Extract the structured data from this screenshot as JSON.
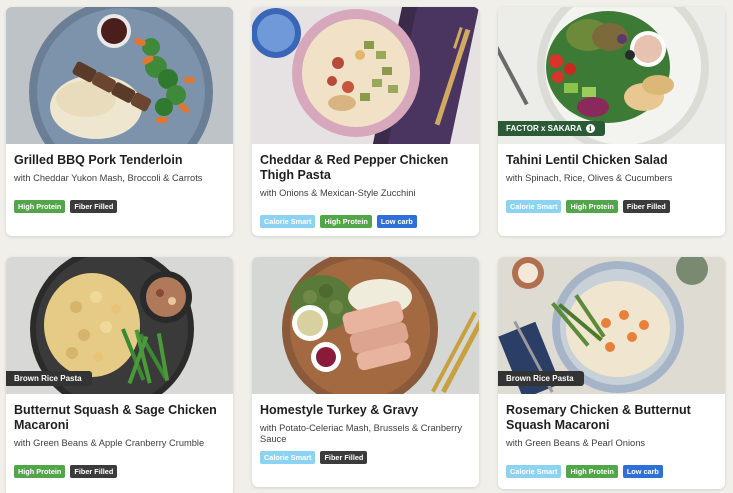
{
  "meals": [
    {
      "title": "Grilled BBQ Pork Tenderloin",
      "subtitle": "with Cheddar Yukon Mash, Broccoli & Carrots",
      "tags": [
        "High Protein",
        "Fiber Filled"
      ],
      "ribbon": ""
    },
    {
      "title": "Cheddar & Red Pepper Chicken Thigh Pasta",
      "subtitle": "with Onions & Mexican-Style Zucchini",
      "tags": [
        "Calorie Smart",
        "High Protein",
        "Low carb"
      ],
      "ribbon": ""
    },
    {
      "title": "Tahini Lentil Chicken Salad",
      "subtitle": "with Spinach, Rice, Olives & Cucumbers",
      "tags": [
        "Calorie Smart",
        "High Protein",
        "Fiber Filled"
      ],
      "ribbon": "FACTOR x SAKARA"
    },
    {
      "title": "Butternut Squash & Sage Chicken Macaroni",
      "subtitle": "with Green Beans & Apple Cranberry Crumble",
      "tags": [
        "High Protein",
        "Fiber Filled"
      ],
      "ribbon": "Brown Rice Pasta"
    },
    {
      "title": "Homestyle Turkey & Gravy",
      "subtitle": "with Potato-Celeriac Mash, Brussels & Cranberry Sauce",
      "tags": [
        "Calorie Smart",
        "Fiber Filled"
      ],
      "ribbon": ""
    },
    {
      "title": "Rosemary Chicken & Butternut Squash Macaroni",
      "subtitle": "with Green Beans & Pearl Onions",
      "tags": [
        "Calorie Smart",
        "High Protein",
        "Low carb"
      ],
      "ribbon": "Brown Rice Pasta"
    }
  ],
  "colors": {
    "high_protein": "#52a548",
    "fiber_filled": "#3b3b3b",
    "calorie_smart": "#8cd3f1",
    "low_carb": "#2f6fd8",
    "ribbon_green": "#2a5a36"
  }
}
